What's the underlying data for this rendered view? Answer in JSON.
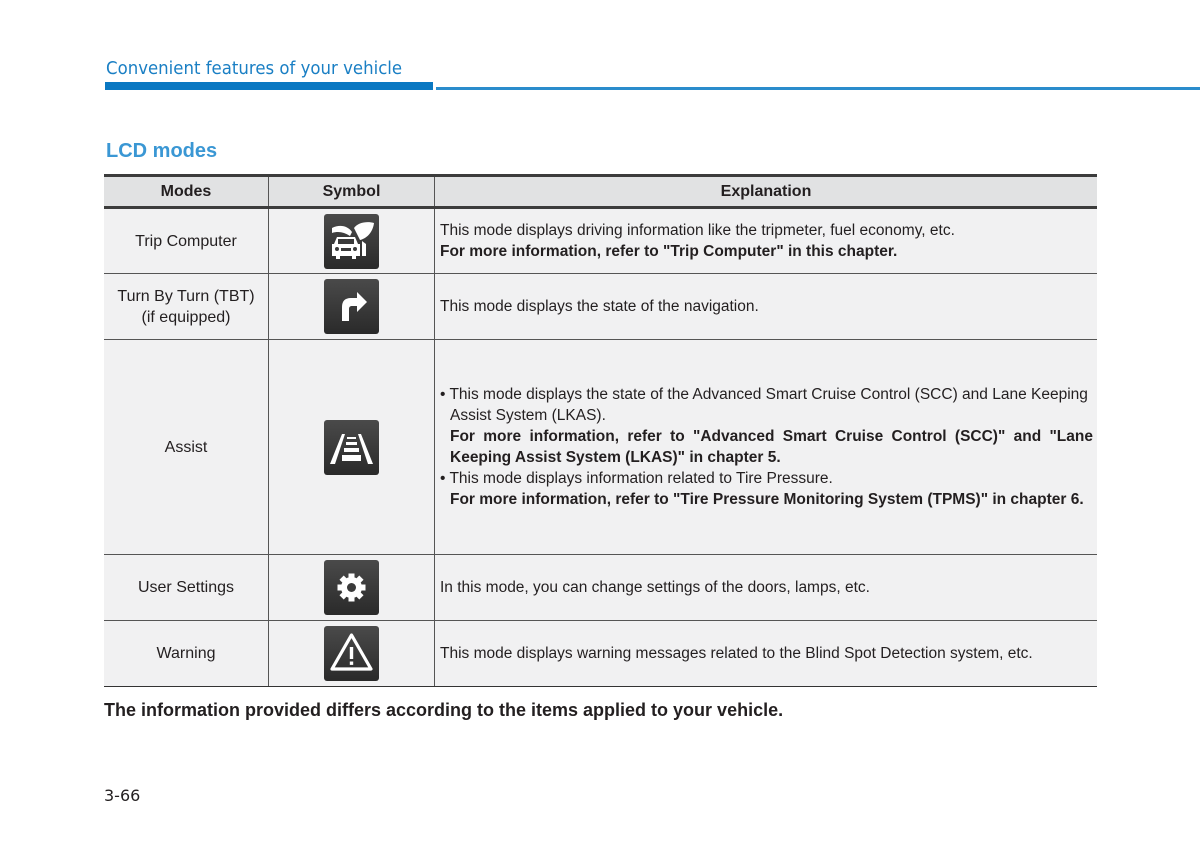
{
  "header": {
    "chapter_title": "Convenient features of your vehicle",
    "accent_color": "#0a78c2"
  },
  "section": {
    "title": "LCD modes"
  },
  "table": {
    "headers": [
      "Modes",
      "Symbol",
      "Explanation"
    ],
    "rows": [
      {
        "mode_lines": [
          "Trip Computer"
        ],
        "symbol": "trip-computer-icon",
        "lines": [
          {
            "style": "normal",
            "text": "This mode displays driving information like the tripmeter, fuel economy, etc."
          },
          {
            "style": "bold",
            "text": "For more information, refer to \"Trip Computer\" in this chapter."
          }
        ]
      },
      {
        "mode_lines": [
          "Turn By Turn (TBT)",
          "(if equipped)"
        ],
        "symbol": "turn-arrow-icon",
        "lines": [
          {
            "style": "normal",
            "text": "This mode displays the state of the navigation."
          }
        ]
      },
      {
        "mode_lines": [
          "Assist"
        ],
        "symbol": "lane-assist-icon",
        "bullets": [
          {
            "text": "This mode displays the state of the Advanced Smart Cruise Control (SCC) and Lane Keeping Assist System (LKAS).",
            "ref": "For more information, refer to \"Advanced Smart Cruise Control (SCC)\" and \"Lane Keeping Assist System (LKAS)\" in chapter 5."
          },
          {
            "text": "This mode displays information related to Tire Pressure.",
            "ref": "For more information, refer to \"Tire Pressure Monitoring System (TPMS)\" in chapter 6."
          }
        ]
      },
      {
        "mode_lines": [
          "User Settings"
        ],
        "symbol": "gear-icon",
        "lines": [
          {
            "style": "normal",
            "text": "In this mode, you can change settings of the doors, lamps, etc."
          }
        ]
      },
      {
        "mode_lines": [
          "Warning"
        ],
        "symbol": "warning-triangle-icon",
        "lines": [
          {
            "style": "normal",
            "text": "This mode displays warning messages related to the Blind Spot Detection system, etc."
          }
        ]
      }
    ]
  },
  "note": "The information provided differs according to the items applied to your vehicle.",
  "page_number": "3-66"
}
